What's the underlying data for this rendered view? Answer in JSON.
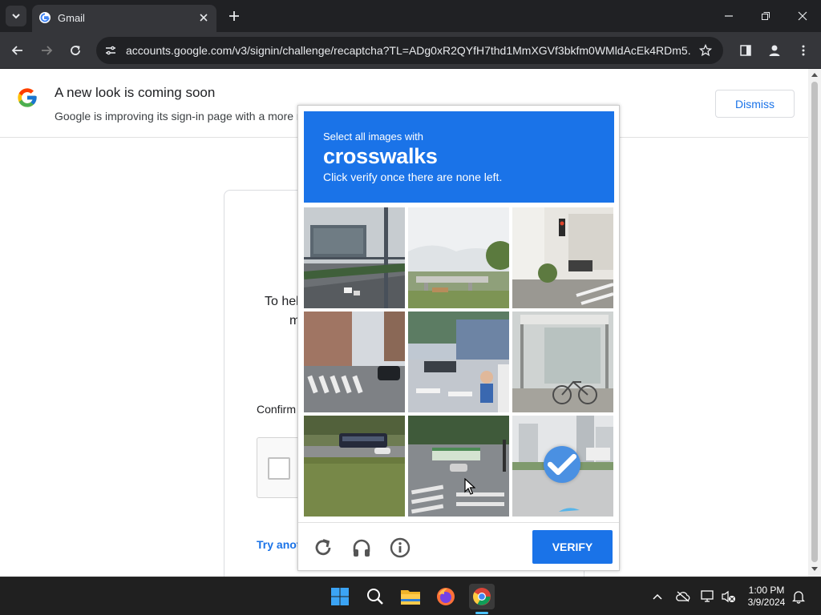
{
  "browser": {
    "tab": {
      "title": "Gmail"
    },
    "url": "accounts.google.com/v3/signin/challenge/recaptcha?TL=ADg0xR2QYfH7thd1MmXGVf3bkfm0WMldAcEk4RDm5..."
  },
  "banner": {
    "title": "A new look is coming soon",
    "subtitle": "Google is improving its sign-in page with a more r",
    "dismiss_label": "Dismiss"
  },
  "signin": {
    "text_fragment_1": "To hel",
    "text_fragment_2": "m",
    "confirm_fragment": "Confirm",
    "try_another_fragment": "Try anot"
  },
  "challenge": {
    "instruction_small": "Select all images with",
    "target": "crosswalks",
    "instruction_detail": "Click verify once there are none left.",
    "verify_label": "VERIFY",
    "tiles": [
      {
        "scene": "highway with overhead sign",
        "selected": false
      },
      {
        "scene": "overpass and trees",
        "selected": false
      },
      {
        "scene": "street corner with traffic light",
        "selected": false
      },
      {
        "scene": "city street with crosswalk",
        "selected": false
      },
      {
        "scene": "street with scooters and crosswalk",
        "selected": false
      },
      {
        "scene": "bus shelter with bicycle",
        "selected": false
      },
      {
        "scene": "bus on road with grass",
        "selected": false
      },
      {
        "scene": "intersection with crosswalk",
        "selected": false
      },
      {
        "scene": "road with buildings",
        "selected": true
      }
    ]
  },
  "taskbar": {
    "apps": [
      "start-icon",
      "search-icon",
      "file-explorer-icon",
      "firefox-icon",
      "chrome-icon"
    ],
    "time": "1:00 PM",
    "date": "3/9/2024"
  },
  "colors": {
    "accent": "#1a73e8",
    "chrome_dark": "#202124",
    "toolbar": "#35363a",
    "check_blue": "#4a90e2"
  }
}
